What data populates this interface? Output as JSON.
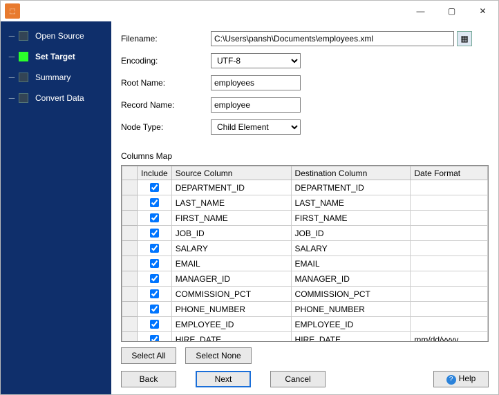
{
  "titlebar": {
    "minimize": "—",
    "maximize": "▢",
    "close": "✕"
  },
  "sidebar": {
    "items": [
      {
        "label": "Open Source"
      },
      {
        "label": "Set Target"
      },
      {
        "label": "Summary"
      },
      {
        "label": "Convert Data"
      }
    ],
    "active_index": 1
  },
  "form": {
    "filename_label": "Filename:",
    "filename_value": "C:\\Users\\pansh\\Documents\\employees.xml",
    "encoding_label": "Encoding:",
    "encoding_value": "UTF-8",
    "rootname_label": "Root Name:",
    "rootname_value": "employees",
    "recordname_label": "Record Name:",
    "recordname_value": "employee",
    "nodetype_label": "Node Type:",
    "nodetype_value": "Child Element"
  },
  "columns": {
    "section_label": "Columns Map",
    "headers": {
      "include": "Include",
      "source": "Source Column",
      "dest": "Destination Column",
      "datefmt": "Date Format"
    },
    "rows": [
      {
        "include": true,
        "source": "DEPARTMENT_ID",
        "dest": "DEPARTMENT_ID",
        "datefmt": ""
      },
      {
        "include": true,
        "source": "LAST_NAME",
        "dest": "LAST_NAME",
        "datefmt": ""
      },
      {
        "include": true,
        "source": "FIRST_NAME",
        "dest": "FIRST_NAME",
        "datefmt": ""
      },
      {
        "include": true,
        "source": "JOB_ID",
        "dest": "JOB_ID",
        "datefmt": ""
      },
      {
        "include": true,
        "source": "SALARY",
        "dest": "SALARY",
        "datefmt": ""
      },
      {
        "include": true,
        "source": "EMAIL",
        "dest": "EMAIL",
        "datefmt": ""
      },
      {
        "include": true,
        "source": "MANAGER_ID",
        "dest": "MANAGER_ID",
        "datefmt": ""
      },
      {
        "include": true,
        "source": "COMMISSION_PCT",
        "dest": "COMMISSION_PCT",
        "datefmt": ""
      },
      {
        "include": true,
        "source": "PHONE_NUMBER",
        "dest": "PHONE_NUMBER",
        "datefmt": ""
      },
      {
        "include": true,
        "source": "EMPLOYEE_ID",
        "dest": "EMPLOYEE_ID",
        "datefmt": ""
      },
      {
        "include": true,
        "source": "HIRE_DATE",
        "dest": "HIRE_DATE",
        "datefmt": "mm/dd/yyyy"
      }
    ]
  },
  "buttons": {
    "select_all": "Select All",
    "select_none": "Select None",
    "back": "Back",
    "next": "Next",
    "cancel": "Cancel",
    "help": "Help"
  }
}
